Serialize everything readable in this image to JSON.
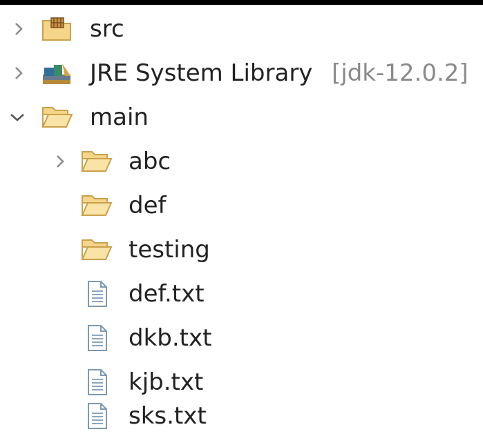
{
  "tree": {
    "items": [
      {
        "label": "src",
        "icon": "package-folder-icon",
        "expand": "collapsed",
        "level": 0
      },
      {
        "label": "JRE System Library",
        "decoration": "[jdk-12.0.2]",
        "icon": "library-icon",
        "expand": "collapsed",
        "level": 0
      },
      {
        "label": "main",
        "icon": "folder-open-icon",
        "expand": "expanded",
        "level": 0
      },
      {
        "label": "abc",
        "icon": "folder-icon",
        "expand": "collapsed",
        "level": 1
      },
      {
        "label": "def",
        "icon": "folder-icon",
        "expand": "none",
        "level": 1
      },
      {
        "label": "testing",
        "icon": "folder-icon",
        "expand": "none",
        "level": 1
      },
      {
        "label": "def.txt",
        "icon": "text-file-icon",
        "expand": "none",
        "level": 1
      },
      {
        "label": "dkb.txt",
        "icon": "text-file-icon",
        "expand": "none",
        "level": 1
      },
      {
        "label": "kjb.txt",
        "icon": "text-file-icon",
        "expand": "none",
        "level": 1
      },
      {
        "label": "sks.txt",
        "icon": "text-file-icon",
        "expand": "none",
        "level": 1
      }
    ]
  },
  "colors": {
    "folder_fill": "#f4d58a",
    "folder_stroke": "#c9a14b",
    "chevron": "#8c8c8c",
    "decoration_text": "#8a8a8a"
  }
}
